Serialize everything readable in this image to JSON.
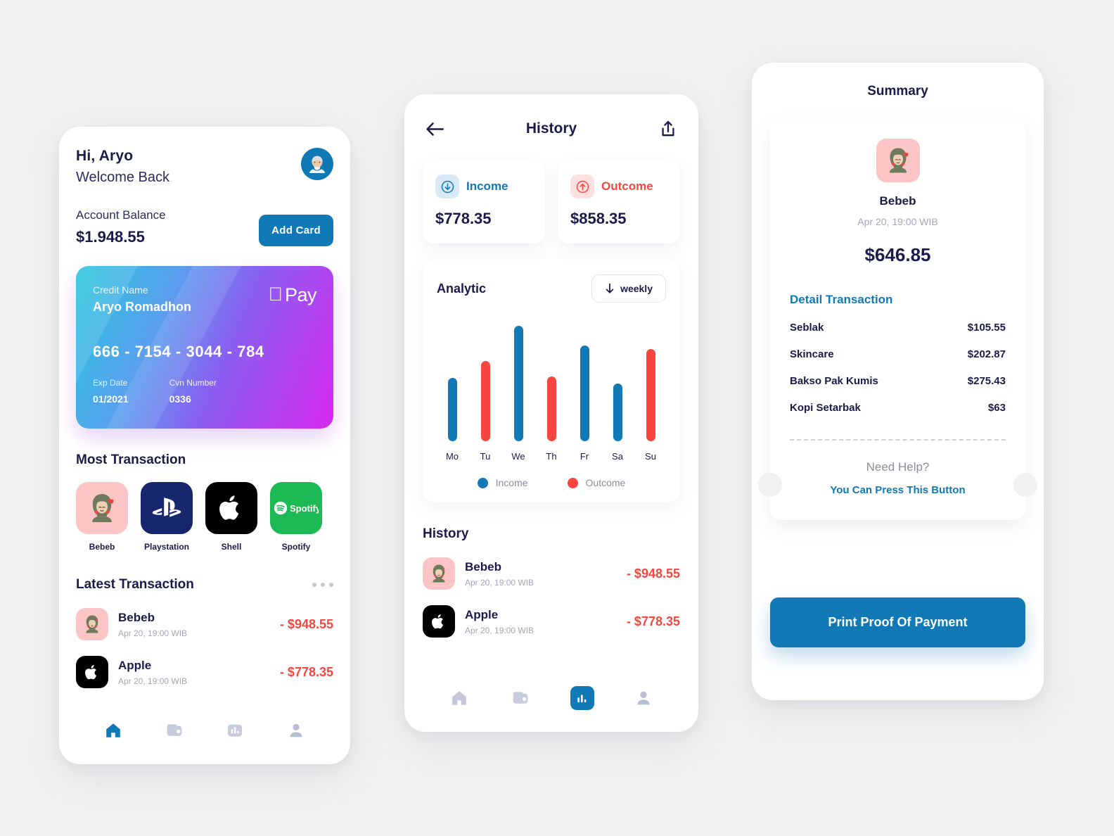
{
  "theme": {
    "page_bg": "#f1f1f1",
    "navy": "#1b1b4b",
    "blue": "#1179b5",
    "red": "#f8463f",
    "grey": "#a6a6b3",
    "spotify_green": "#1db954",
    "playstation_navy": "#16276e",
    "pink_tile": "#fbc5c5"
  },
  "home": {
    "greeting": "Hi, Aryo",
    "subgreeting": "Welcome Back",
    "avatar_icon": "memoji-man-avatar",
    "balance_label": "Account Balance",
    "balance_value": "$1.948.55",
    "add_card_label": "Add Card",
    "card": {
      "name_label": "Credit Name",
      "name_value": "Aryo Romadhon",
      "pay_brand": "Pay",
      "pay_logo_icon": "apple-logo-icon",
      "number": "666 - 7154 - 3044 - 784",
      "exp_label": "Exp Date",
      "exp_value": "01/2021",
      "cvn_label": "Cvn Number",
      "cvn_value": "0336"
    },
    "most_transaction": {
      "title": "Most Transaction",
      "items": [
        {
          "label": "Bebeb",
          "icon": "memoji-woman-hijab-icon"
        },
        {
          "label": "Playstation",
          "icon": "playstation-logo-icon"
        },
        {
          "label": "Shell",
          "icon": "apple-logo-icon"
        },
        {
          "label": "Spotify",
          "icon": "spotify-logo-icon"
        }
      ]
    },
    "latest_transaction": {
      "title": "Latest Transaction",
      "more_icon": "three-dots-icon",
      "rows": [
        {
          "name": "Bebeb",
          "time": "Apr 20, 19:00 WIB",
          "amount": "- $948.55",
          "icon": "memoji-woman-hijab-icon"
        },
        {
          "name": "Apple",
          "time": "Apr 20, 19:00 WIB",
          "amount": "- $778.35",
          "icon": "apple-logo-icon"
        }
      ]
    },
    "nav": [
      {
        "icon": "home-icon",
        "active": true
      },
      {
        "icon": "wallet-icon",
        "active": false
      },
      {
        "icon": "bar-chart-icon",
        "active": false
      },
      {
        "icon": "person-icon",
        "active": false
      }
    ]
  },
  "history": {
    "back_icon": "arrow-left-icon",
    "title": "History",
    "share_icon": "share-icon",
    "income": {
      "label": "Income",
      "value": "$778.35",
      "icon": "arrow-down-circle-icon"
    },
    "outcome": {
      "label": "Outcome",
      "value": "$858.35",
      "icon": "arrow-up-circle-icon"
    },
    "analytic": {
      "title": "Analytic",
      "range_label": "weekly",
      "range_icon": "arrow-down-icon"
    },
    "list_title": "History",
    "rows": [
      {
        "name": "Bebeb",
        "time": "Apr 20, 19:00 WIB",
        "amount": "- $948.55",
        "icon": "memoji-woman-hijab-icon"
      },
      {
        "name": "Apple",
        "time": "Apr 20, 19:00 WIB",
        "amount": "- $778.35",
        "icon": "apple-logo-icon"
      }
    ],
    "nav": [
      {
        "icon": "home-icon",
        "active": false
      },
      {
        "icon": "wallet-icon",
        "active": false
      },
      {
        "icon": "bar-chart-icon",
        "active": true
      },
      {
        "icon": "person-icon",
        "active": false
      }
    ]
  },
  "summary": {
    "title": "Summary",
    "avatar_icon": "memoji-woman-hijab-icon",
    "name": "Bebeb",
    "time": "Apr 20, 19:00 WIB",
    "total": "$646.85",
    "detail_title": "Detail Transaction",
    "details": [
      {
        "label": "Seblak",
        "amount": "$105.55"
      },
      {
        "label": "Skincare",
        "amount": "$202.87"
      },
      {
        "label": "Bakso Pak Kumis",
        "amount": "$275.43"
      },
      {
        "label": "Kopi Setarbak",
        "amount": "$63"
      }
    ],
    "help_question": "Need Help?",
    "help_action": "You Can Press This Button",
    "print_label": "Print Proof Of Payment"
  },
  "chart_data": {
    "type": "bar",
    "title": "Analytic",
    "xlabel": "",
    "ylabel": "",
    "categories": [
      "Mo",
      "Tu",
      "We",
      "Th",
      "Fr",
      "Sa",
      "Su"
    ],
    "values": [
      100,
      127,
      182,
      102,
      151,
      91,
      145
    ],
    "bar_series": [
      "Income",
      "Outcome",
      "Income",
      "Outcome",
      "Income",
      "Income",
      "Outcome"
    ],
    "colors": {
      "Income": "#1179b5",
      "Outcome": "#f8463f"
    },
    "legend": [
      {
        "name": "Income",
        "color": "#1179b5"
      },
      {
        "name": "Outcome",
        "color": "#f8463f"
      }
    ],
    "legend_position": "bottom",
    "ylim": [
      0,
      200
    ],
    "grid": false,
    "range": "weekly"
  }
}
